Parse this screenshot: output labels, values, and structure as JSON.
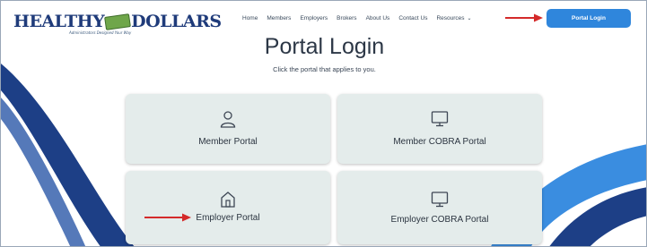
{
  "brand": {
    "logo_text_left": "HEALTHY",
    "logo_text_right": "DOLLARS",
    "tagline": "Administrators Designed Your Way"
  },
  "nav": {
    "items": [
      "Home",
      "Members",
      "Employers",
      "Brokers",
      "About Us",
      "Contact Us",
      "Resources"
    ]
  },
  "header": {
    "portal_login_label": "Portal Login"
  },
  "main": {
    "title": "Portal Login",
    "subtitle": "Click the portal that applies to you."
  },
  "portals": [
    {
      "label": "Member Portal",
      "icon": "person-icon"
    },
    {
      "label": "Member COBRA Portal",
      "icon": "monitor-icon"
    },
    {
      "label": "Employer Portal",
      "icon": "building-icon"
    },
    {
      "label": "Employer COBRA Portal",
      "icon": "monitor-icon"
    }
  ],
  "colors": {
    "brand_navy": "#1f3b7a",
    "accent_blue": "#2f86dc",
    "card_bg": "#e4eceb",
    "annotation_red": "#d42a2a"
  }
}
